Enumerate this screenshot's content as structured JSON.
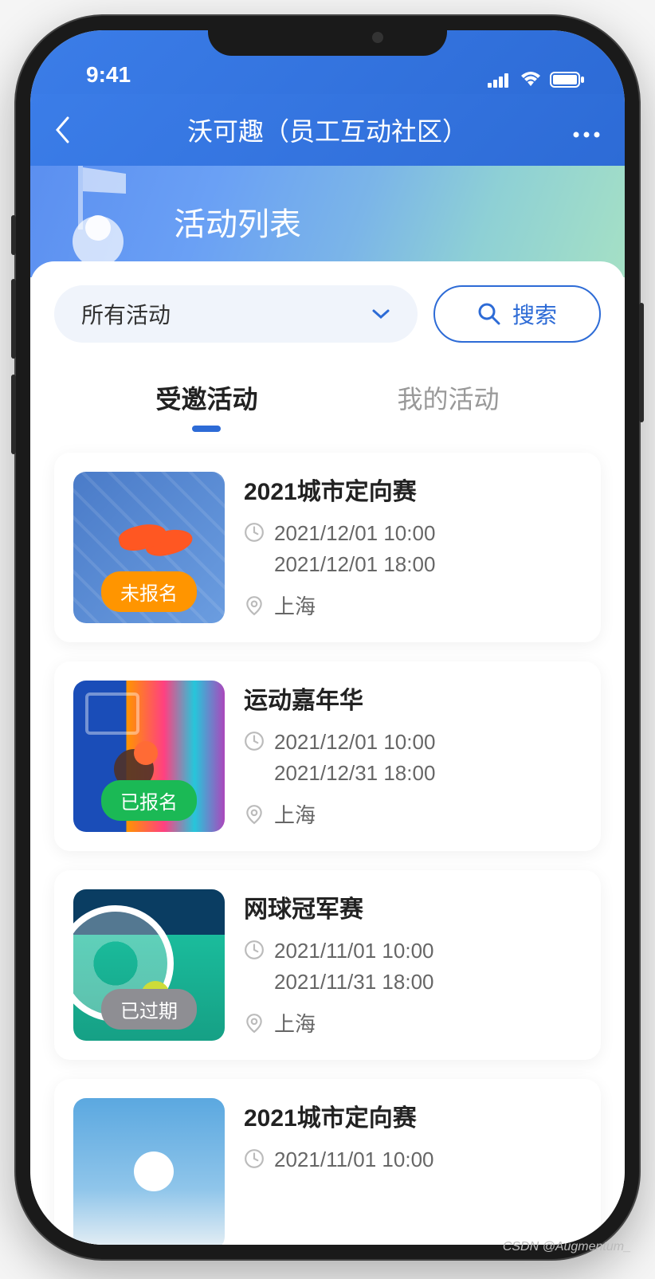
{
  "status_bar": {
    "time": "9:41"
  },
  "nav": {
    "title": "沃可趣（员工互动社区）"
  },
  "hero": {
    "title": "活动列表"
  },
  "filter": {
    "dropdown_label": "所有活动",
    "search_label": "搜索"
  },
  "tabs": {
    "items": [
      {
        "label": "受邀活动",
        "active": true
      },
      {
        "label": "我的活动",
        "active": false
      }
    ]
  },
  "events": [
    {
      "title": "2021城市定向赛",
      "start": "2021/12/01 10:00",
      "end": "2021/12/01 18:00",
      "location": "上海",
      "badge": {
        "text": "未报名",
        "color": "orange"
      },
      "thumb": "thumb1"
    },
    {
      "title": "运动嘉年华",
      "start": "2021/12/01 10:00",
      "end": "2021/12/31 18:00",
      "location": "上海",
      "badge": {
        "text": "已报名",
        "color": "green"
      },
      "thumb": "thumb2"
    },
    {
      "title": "网球冠军赛",
      "start": "2021/11/01 10:00",
      "end": "2021/11/31 18:00",
      "location": "上海",
      "badge": {
        "text": "已过期",
        "color": "gray"
      },
      "thumb": "thumb3"
    },
    {
      "title": "2021城市定向赛",
      "start": "2021/11/01 10:00",
      "end": "",
      "location": "",
      "badge": null,
      "thumb": "thumb4"
    }
  ],
  "watermark": "CSDN @Augmentum_"
}
